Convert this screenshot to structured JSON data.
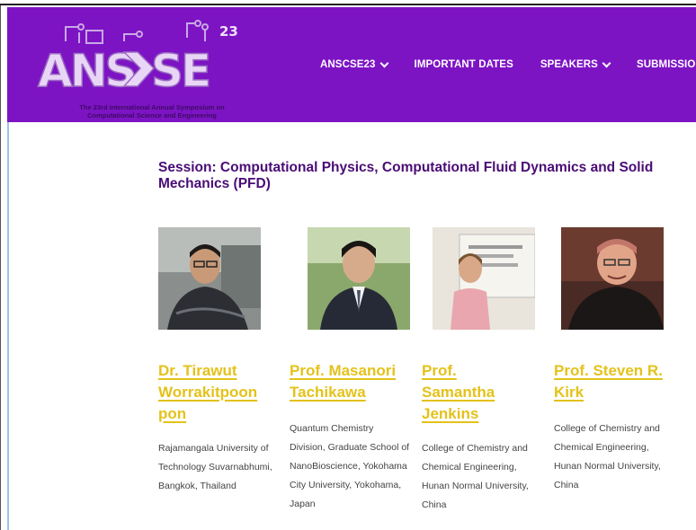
{
  "header": {
    "logo_text": "ANSCSE",
    "logo_badge": "23",
    "logo_subtitle_line1": "The 23rd International Annual Symposium on",
    "logo_subtitle_line2": "Computational Science and Engineering",
    "nav": [
      {
        "label": "ANSCSE23",
        "has_dropdown": true
      },
      {
        "label": "IMPORTANT DATES",
        "has_dropdown": false
      },
      {
        "label": "SPEAKERS",
        "has_dropdown": true
      },
      {
        "label": "SUBMISSION",
        "has_dropdown": false
      }
    ]
  },
  "session": {
    "title": "Session: Computational Physics, Computational Fluid Dynamics and Solid Mechanics (PFD)"
  },
  "speakers": [
    {
      "name_lines": [
        "Dr. Tirawut",
        "Worrakitpoon",
        "pon"
      ],
      "aff_lines": [
        "Rajamangala University of",
        "Technology Suvarnabhumi,",
        "Bangkok, Thailand"
      ]
    },
    {
      "name_lines": [
        "Prof. Masanori",
        "Tachikawa"
      ],
      "aff_lines": [
        "Quantum Chemistry",
        "Division, Graduate School of",
        "NanoBioscience, Yokohama",
        "City University, Yokohama,",
        "Japan"
      ]
    },
    {
      "name_lines": [
        "Prof.",
        "Samantha",
        "Jenkins"
      ],
      "aff_lines": [
        "College of Chemistry and",
        "Chemical Engineering,",
        "Hunan Normal University,",
        "China"
      ]
    },
    {
      "name_lines": [
        "Prof. Steven R.",
        "Kirk"
      ],
      "aff_lines": [
        "College of Chemistry and",
        "Chemical Engineering,",
        "Hunan Normal University,",
        "China"
      ]
    }
  ],
  "colors": {
    "header_bg": "#7d14c4",
    "accent_name": "#e4c21b",
    "session_title": "#4a0c75"
  }
}
